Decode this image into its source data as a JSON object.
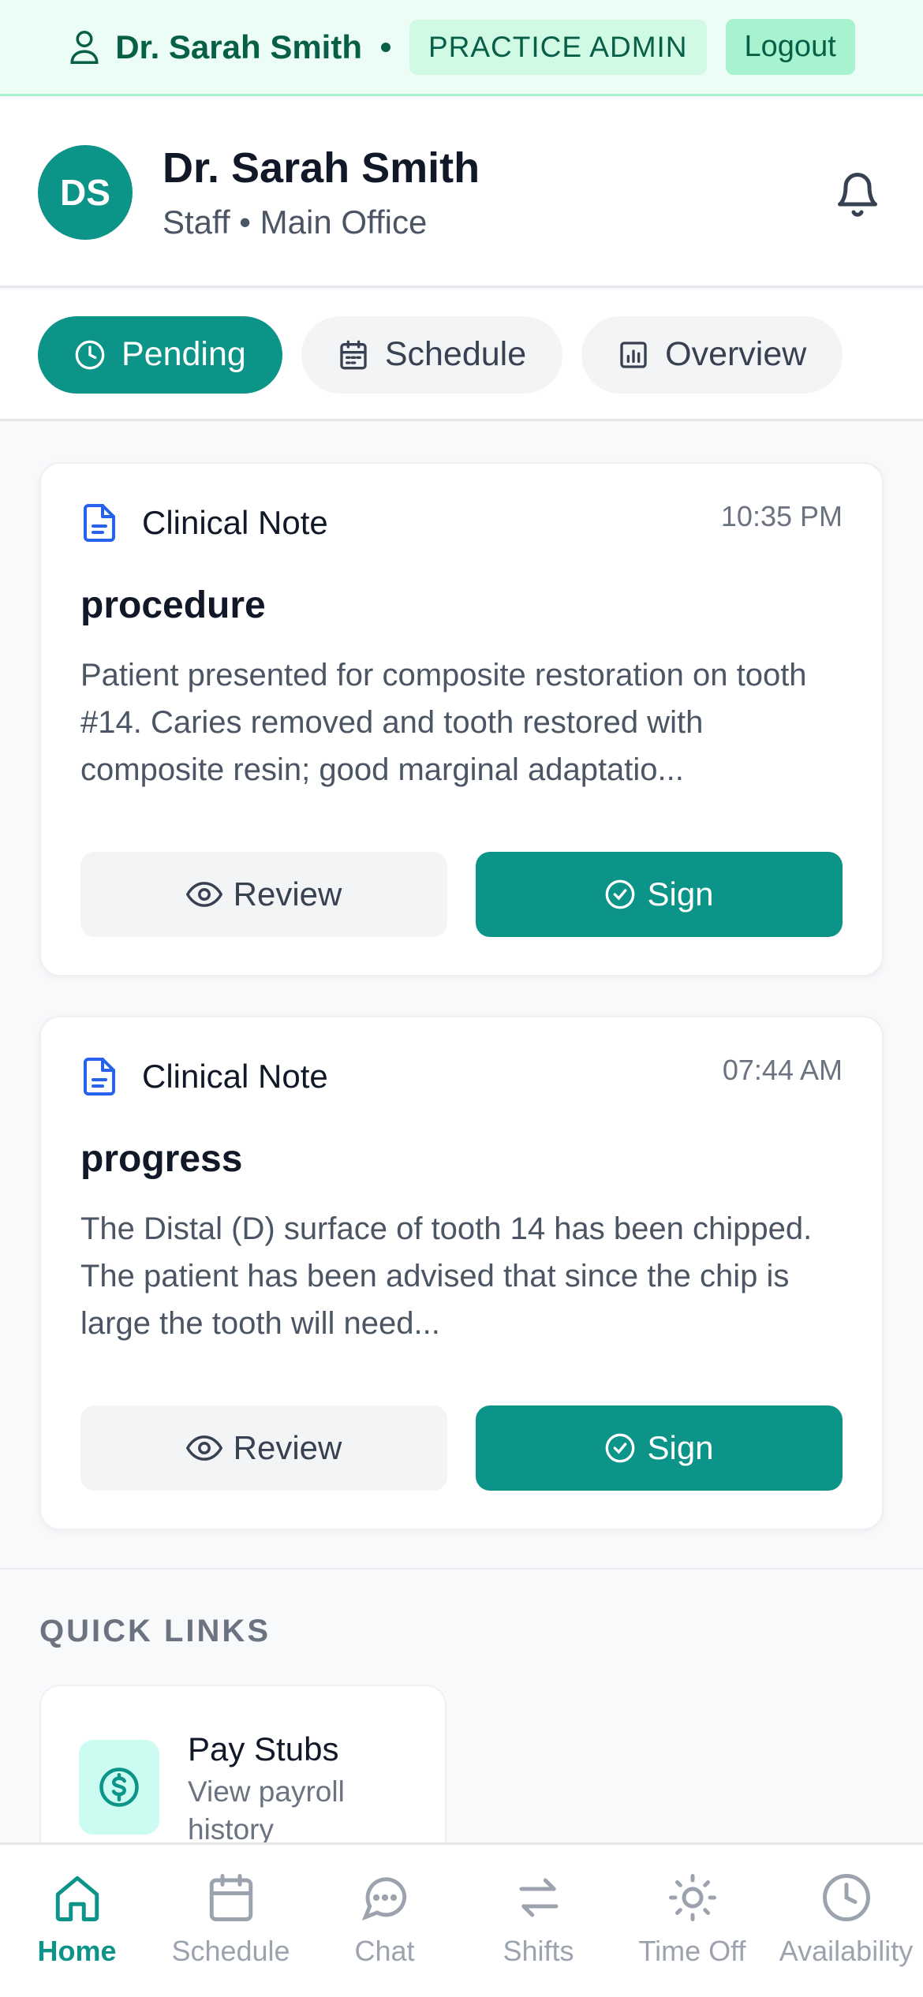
{
  "topbar": {
    "user_name": "Dr. Sarah Smith",
    "role": "PRACTICE ADMIN",
    "logout_label": "Logout"
  },
  "profile": {
    "initials": "DS",
    "name": "Dr. Sarah Smith",
    "subtitle": "Staff • Main Office"
  },
  "tabs": [
    {
      "label": "Pending",
      "icon": "clock-icon",
      "active": true
    },
    {
      "label": "Schedule",
      "icon": "calendar-icon",
      "active": false
    },
    {
      "label": "Overview",
      "icon": "bar-chart-icon",
      "active": false
    }
  ],
  "cards": [
    {
      "type": "Clinical Note",
      "time": "10:35 PM",
      "title": "procedure",
      "body": "Patient presented for composite restoration on tooth #14. Caries removed and tooth restored with composite resin; good marginal adaptatio...",
      "review_label": "Review",
      "sign_label": "Sign"
    },
    {
      "type": "Clinical Note",
      "time": "07:44 AM",
      "title": "progress",
      "body": "The Distal (D) surface of tooth 14 has been chipped. The patient has been advised that since the chip is large the tooth will need...",
      "review_label": "Review",
      "sign_label": "Sign"
    }
  ],
  "quick_links": {
    "heading": "QUICK LINKS",
    "items": [
      {
        "title": "Pay Stubs",
        "desc": "View payroll history",
        "icon": "dollar-icon"
      }
    ]
  },
  "bottom_nav": [
    {
      "label": "Home",
      "icon": "home-icon",
      "active": true
    },
    {
      "label": "Schedule",
      "icon": "calendar-icon",
      "active": false
    },
    {
      "label": "Chat",
      "icon": "chat-icon",
      "active": false
    },
    {
      "label": "Shifts",
      "icon": "swap-icon",
      "active": false
    },
    {
      "label": "Time Off",
      "icon": "sun-icon",
      "active": false
    },
    {
      "label": "Availability",
      "icon": "clock-icon",
      "active": false
    }
  ],
  "colors": {
    "accent": "#0d9488",
    "topbar_bg": "#ecfdf5",
    "topbar_text": "#065f46",
    "icon_blue": "#2563eb"
  }
}
